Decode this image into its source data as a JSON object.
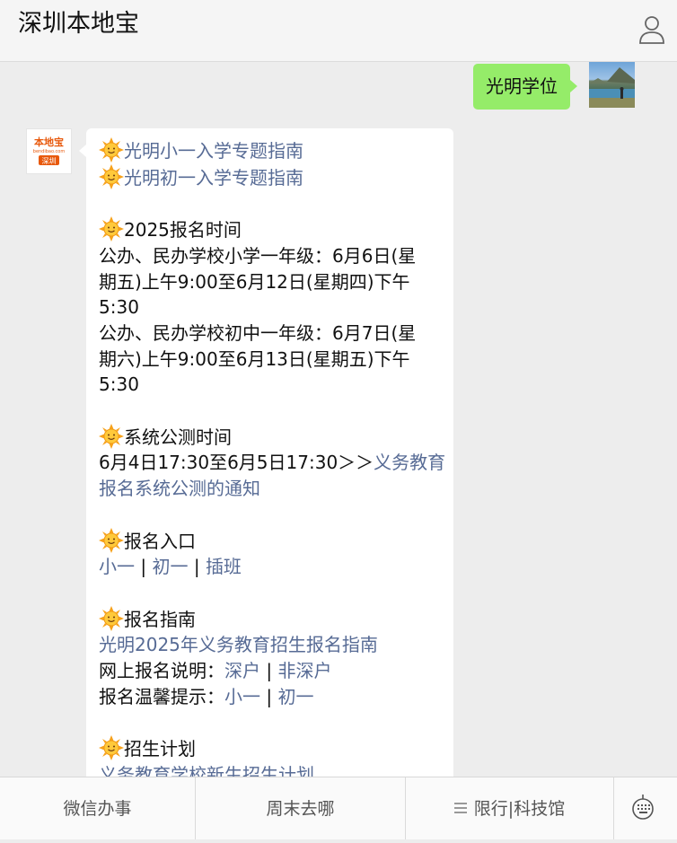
{
  "header": {
    "title": "深圳本地宝",
    "profile_icon": "person-icon"
  },
  "outgoing": {
    "text": "光明学位"
  },
  "bot_avatar": {
    "logo_top": "本地宝",
    "logo_domain": "bendibao.com",
    "logo_city": "深圳"
  },
  "message": {
    "guide_primary": "光明小一入学专题指南",
    "guide_junior": "光明初一入学专题指南",
    "reg_time_title": "2025报名时间",
    "primary_l1": "公办、民办学校小学一年级：6月6日(星",
    "primary_l2": "期五)上午9:00至6月12日(星期四)下午",
    "primary_l3": "5:30",
    "junior_l1": "公办、民办学校初中一年级：6月7日(星",
    "junior_l2": "期六)上午9:00至6月13日(星期五)下午",
    "junior_l3": "5:30",
    "test_title": "系统公测时间",
    "test_l1_text": "6月4日17:30至6月5日17:30＞＞",
    "test_l1_link": "义务教育",
    "test_l2_link": "报名系统公测的通知",
    "entry_title": "报名入口",
    "entry_link1": "小一",
    "entry_link2": "初一",
    "entry_link3": "插班",
    "sep": "|",
    "guide_title": "报名指南",
    "guide_link": "光明2025年义务教育招生报名指南",
    "online_label": "网上报名说明：",
    "online_link1": "深户",
    "online_link2": "非深户",
    "tips_label": "报名温馨提示：",
    "tips_link1": "小一",
    "tips_link2": "初一",
    "plan_title": "招生计划",
    "plan_link": "义务教育学校新生招生计划"
  },
  "footer": {
    "tab1": "微信办事",
    "tab2": "周末去哪",
    "tab3": "限行|科技馆",
    "keyboard_icon": "keyboard-icon"
  },
  "colors": {
    "link": "#576b95",
    "bubble_out": "#95ec69",
    "background": "#ededed"
  }
}
